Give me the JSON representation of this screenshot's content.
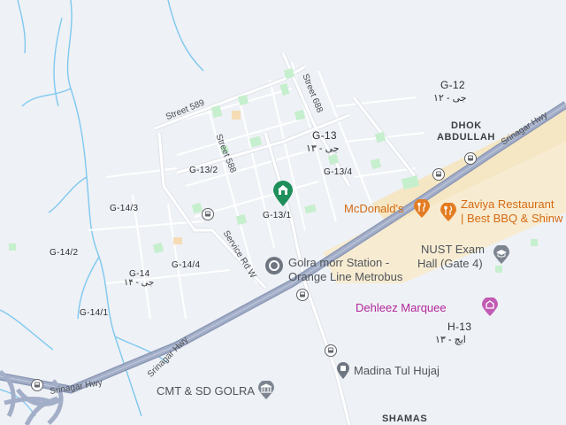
{
  "labels": {
    "g12": "G-12",
    "g12_urdu": "جی - ۱۲",
    "dhok": "DHOK",
    "abdullah": "ABDULLAH",
    "g13": "G-13",
    "g13_urdu": "جی - ۱۳",
    "g13_4": "G-13/4",
    "g13_2": "G-13/2",
    "g13_1": "G-13/1",
    "g14_3": "G-14/3",
    "g14_2": "G-14/2",
    "g14": "G-14",
    "g14_urdu": "جی - ۱۴",
    "g14_4": "G-14/4",
    "g14_1": "G-14/1",
    "h13": "H-13",
    "h13_urdu": "ایچ - ۱۳",
    "shamas": "SHAMAS"
  },
  "streets": {
    "street_589": "Street 589",
    "street_588": "Street 588",
    "street_688": "Street 688",
    "service_rd": "Service Rd W",
    "srinagar_hwy_1": "Srinagar Hwy",
    "srinagar_hwy_2": "Srinagar Hwy",
    "srinagar_hwy_3": "Srinagar Hwy"
  },
  "pois": {
    "mcdonalds": "McDonald's",
    "zaviya_line1": "Zaviya Restaurant",
    "zaviya_line2": "| Best BBQ & Shinw",
    "golra_line1": "Golra morr Station -",
    "golra_line2": "Orange Line Metrobus",
    "nust_line1": "NUST Exam",
    "nust_line2": "Hall (Gate 4)",
    "dehleez": "Dehleez Marquee",
    "madina": "Madina Tul Hujaj",
    "cmt": "CMT & SD GOLRA"
  },
  "icons": {
    "selected_pin": "home-pin-icon",
    "bus": "bus-stop-icon",
    "restaurant": "restaurant-icon",
    "station": "transit-station-icon",
    "school": "school-icon",
    "venue": "venue-icon",
    "travel": "travel-agency-icon",
    "museum": "landmark-icon"
  },
  "colors": {
    "land": "#eef1f5",
    "road": "#ffffff",
    "highway": "#9aa5c0",
    "water": "#7ec8f0",
    "park": "#c6efcd",
    "urban": "#f7e9c9",
    "pin_green": "#1e8e5a",
    "poi_orange": "#d56a12",
    "poi_pink": "#b4279c",
    "poi_gray": "#6b7177"
  }
}
